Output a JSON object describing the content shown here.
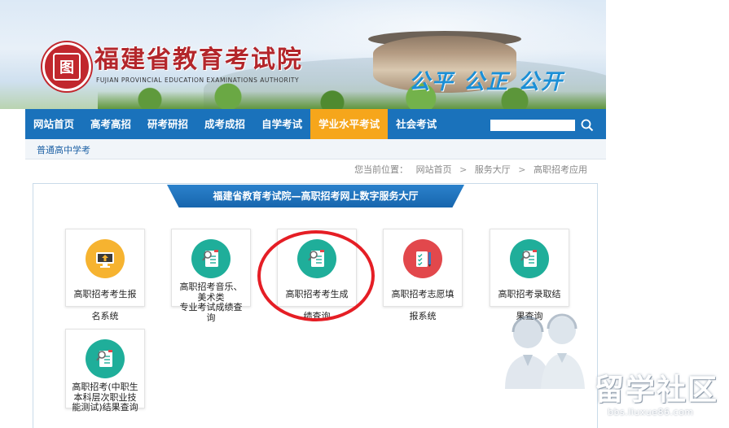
{
  "header": {
    "title": "福建省教育考试院",
    "subtitle": "FUJIAN PROVINCIAL EDUCATION EXAMINATIONS AUTHORITY",
    "slogan": "公平 公正 公开",
    "logo_char": "图"
  },
  "nav": {
    "items": [
      {
        "label": "网站首页",
        "active": false
      },
      {
        "label": "高考高招",
        "active": false
      },
      {
        "label": "研考研招",
        "active": false
      },
      {
        "label": "成考成招",
        "active": false
      },
      {
        "label": "自学考试",
        "active": false
      },
      {
        "label": "学业水平考试",
        "active": true
      },
      {
        "label": "社会考试",
        "active": false
      }
    ],
    "search_value": "",
    "active_color": "#f6a61b",
    "bar_color": "#1a72bb"
  },
  "subnav": {
    "item": "普通高中学考"
  },
  "breadcrumb": {
    "prefix": "您当前位置：",
    "items": [
      "网站首页",
      "服务大厅",
      "高职招考应用"
    ],
    "separator": ">"
  },
  "panel": {
    "title": "福建省教育考试院—高职招考网上数字服务大厅",
    "tiles": [
      {
        "id": "tile-1",
        "icon": "monitor-upload-icon",
        "color": "orange",
        "label_inside": "高职招考考生报",
        "label_below": "名系统"
      },
      {
        "id": "tile-2",
        "icon": "document-search-icon",
        "color": "teal",
        "label_inside": "高职招考音乐、\n美术类\n专业考试成绩查\n询",
        "label_below": ""
      },
      {
        "id": "tile-3",
        "icon": "document-search-icon",
        "color": "teal",
        "label_inside": "高职招考考生成",
        "label_below": "绩查询"
      },
      {
        "id": "tile-4",
        "icon": "clipboard-pen-icon",
        "color": "red",
        "label_inside": "高职招考志愿填",
        "label_below": "报系统"
      },
      {
        "id": "tile-5",
        "icon": "document-search-icon",
        "color": "teal",
        "label_inside": "高职招考录取结",
        "label_below": "果查询"
      },
      {
        "id": "tile-6",
        "icon": "document-search-icon",
        "color": "teal",
        "label_inside": "高职招考(中职生\n本科层次职业技\n能测试)结果查询",
        "label_below": ""
      }
    ]
  },
  "watermark": {
    "main": "留学社区",
    "sub": "bbs.liuxue86.com"
  },
  "colors": {
    "brand_red": "#b3262b",
    "slogan_blue": "#1b8fd6",
    "annotation_red": "#e51e25",
    "teal": "#1fae9a",
    "orange": "#f6b330",
    "red": "#e2484c"
  }
}
